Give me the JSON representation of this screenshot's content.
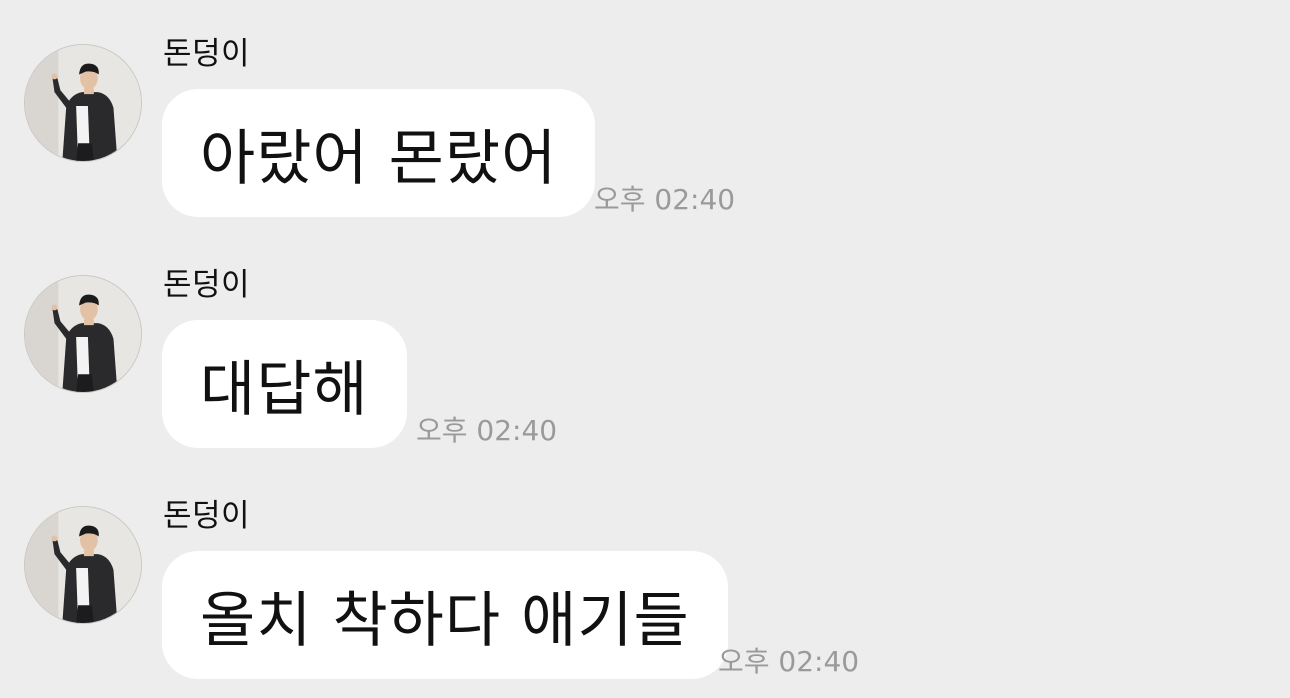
{
  "messages": [
    {
      "sender": "돈덩이",
      "text": "아랐어 몬랐어",
      "time": "오후 02:40"
    },
    {
      "sender": "돈덩이",
      "text": "대답해",
      "time": "오후 02:40"
    },
    {
      "sender": "돈덩이",
      "text": "올치 착하다 애기들",
      "time": "오후 02:40"
    }
  ],
  "colors": {
    "background": "#ededed",
    "bubble": "#ffffff",
    "time_text": "#9a9a9a"
  }
}
